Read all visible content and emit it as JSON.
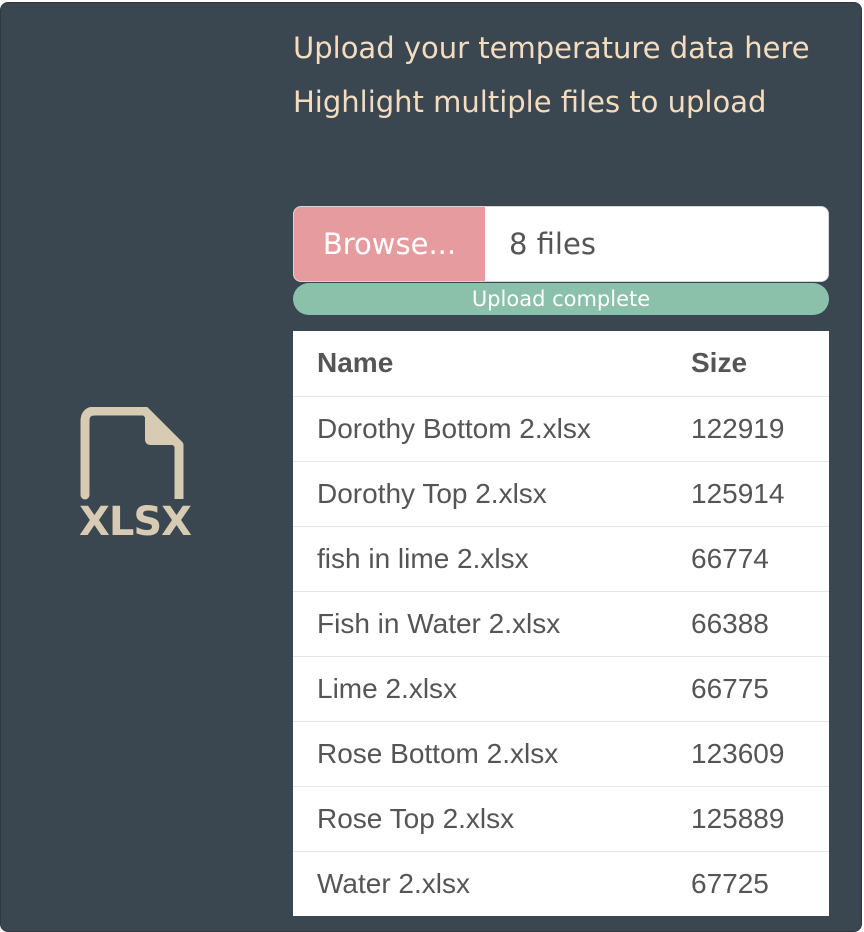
{
  "file_icon": {
    "icon": "file-xlsx-icon",
    "label": "XLSX"
  },
  "headings": {
    "upload_title": "Upload your temperature data here",
    "upload_hint": "Highlight multiple files to upload"
  },
  "file_input": {
    "browse_label": "Browse...",
    "value": "8 files"
  },
  "progress": {
    "label": "Upload complete",
    "percent": 100
  },
  "table": {
    "headers": [
      "Name",
      "Size"
    ],
    "rows": [
      [
        "Dorothy Bottom 2.xlsx",
        "122919"
      ],
      [
        "Dorothy Top 2.xlsx",
        "125914"
      ],
      [
        "fish in lime 2.xlsx",
        "66774"
      ],
      [
        "Fish in Water 2.xlsx",
        "66388"
      ],
      [
        "Lime 2.xlsx",
        "66775"
      ],
      [
        "Rose Bottom 2.xlsx",
        "123609"
      ],
      [
        "Rose Top 2.xlsx",
        "125889"
      ],
      [
        "Water 2.xlsx",
        "67725"
      ]
    ]
  },
  "colors": {
    "panel_bg": "#3a4650",
    "heading": "#f4dcc0",
    "browse_button": "#e69c9f",
    "progress_fill": "#8bc0ab",
    "icon": "#d7cbb4"
  }
}
